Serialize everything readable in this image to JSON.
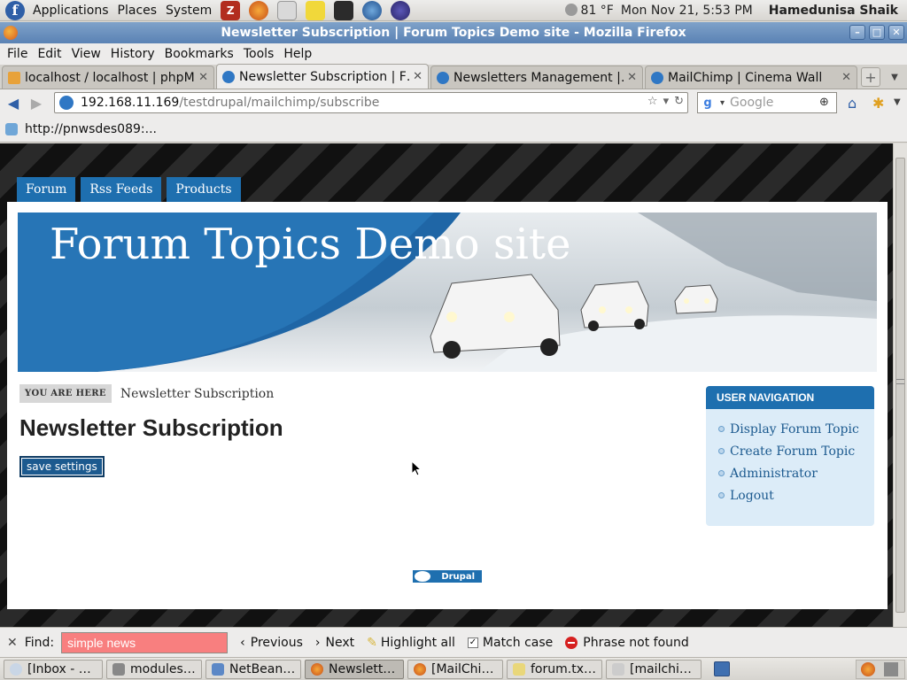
{
  "top_panel": {
    "menus": [
      "Applications",
      "Places",
      "System"
    ],
    "weather": "81 °F",
    "datetime": "Mon Nov 21,  5:53 PM",
    "user": "Hamedunisa Shaik"
  },
  "window": {
    "title": "Newsletter Subscription | Forum Topics Demo site - Mozilla Firefox"
  },
  "menubar": [
    "File",
    "Edit",
    "View",
    "History",
    "Bookmarks",
    "Tools",
    "Help"
  ],
  "tabs": [
    {
      "title": "localhost / localhost | phpM…",
      "active": false
    },
    {
      "title": "Newsletter Subscription | F…",
      "active": true
    },
    {
      "title": "Newsletters Management |…",
      "active": false
    },
    {
      "title": "MailChimp | Cinema Wall",
      "active": false
    }
  ],
  "navbar": {
    "url_host": "192.168.11.169",
    "url_path": "/testdrupal/mailchimp/subscribe",
    "search_placeholder": "Google"
  },
  "bookmarks": {
    "item": "http://pnwsdes089:..."
  },
  "site": {
    "primary_links": [
      "Forum",
      "Rss Feeds",
      "Products"
    ],
    "site_name": "Forum Topics Demo site",
    "breadcrumb_label": "YOU ARE HERE",
    "breadcrumb_current": "Newsletter Subscription",
    "page_title": "Newsletter Subscription",
    "save_button": "save settings",
    "sidebar": {
      "title": "USER NAVIGATION",
      "links": [
        "Display Forum Topic",
        "Create Forum Topic",
        "Administrator",
        "Logout"
      ]
    },
    "powered_by": "Drupal"
  },
  "findbar": {
    "label": "Find:",
    "query": "simple news",
    "previous": "Previous",
    "next": "Next",
    "highlight_all": "Highlight all",
    "match_case": "Match case",
    "match_case_checked": true,
    "status": "Phrase not found"
  },
  "taskbar": [
    {
      "label": "[Inbox - …",
      "active": false
    },
    {
      "label": "modules…",
      "active": false
    },
    {
      "label": "NetBean…",
      "active": false
    },
    {
      "label": "Newslett…",
      "active": true
    },
    {
      "label": "[MailChi…",
      "active": false
    },
    {
      "label": "forum.tx…",
      "active": false
    },
    {
      "label": "[mailchi…",
      "active": false
    }
  ],
  "colors": {
    "drupal_blue": "#1e6faf",
    "find_not_found": "#f87f7f"
  }
}
